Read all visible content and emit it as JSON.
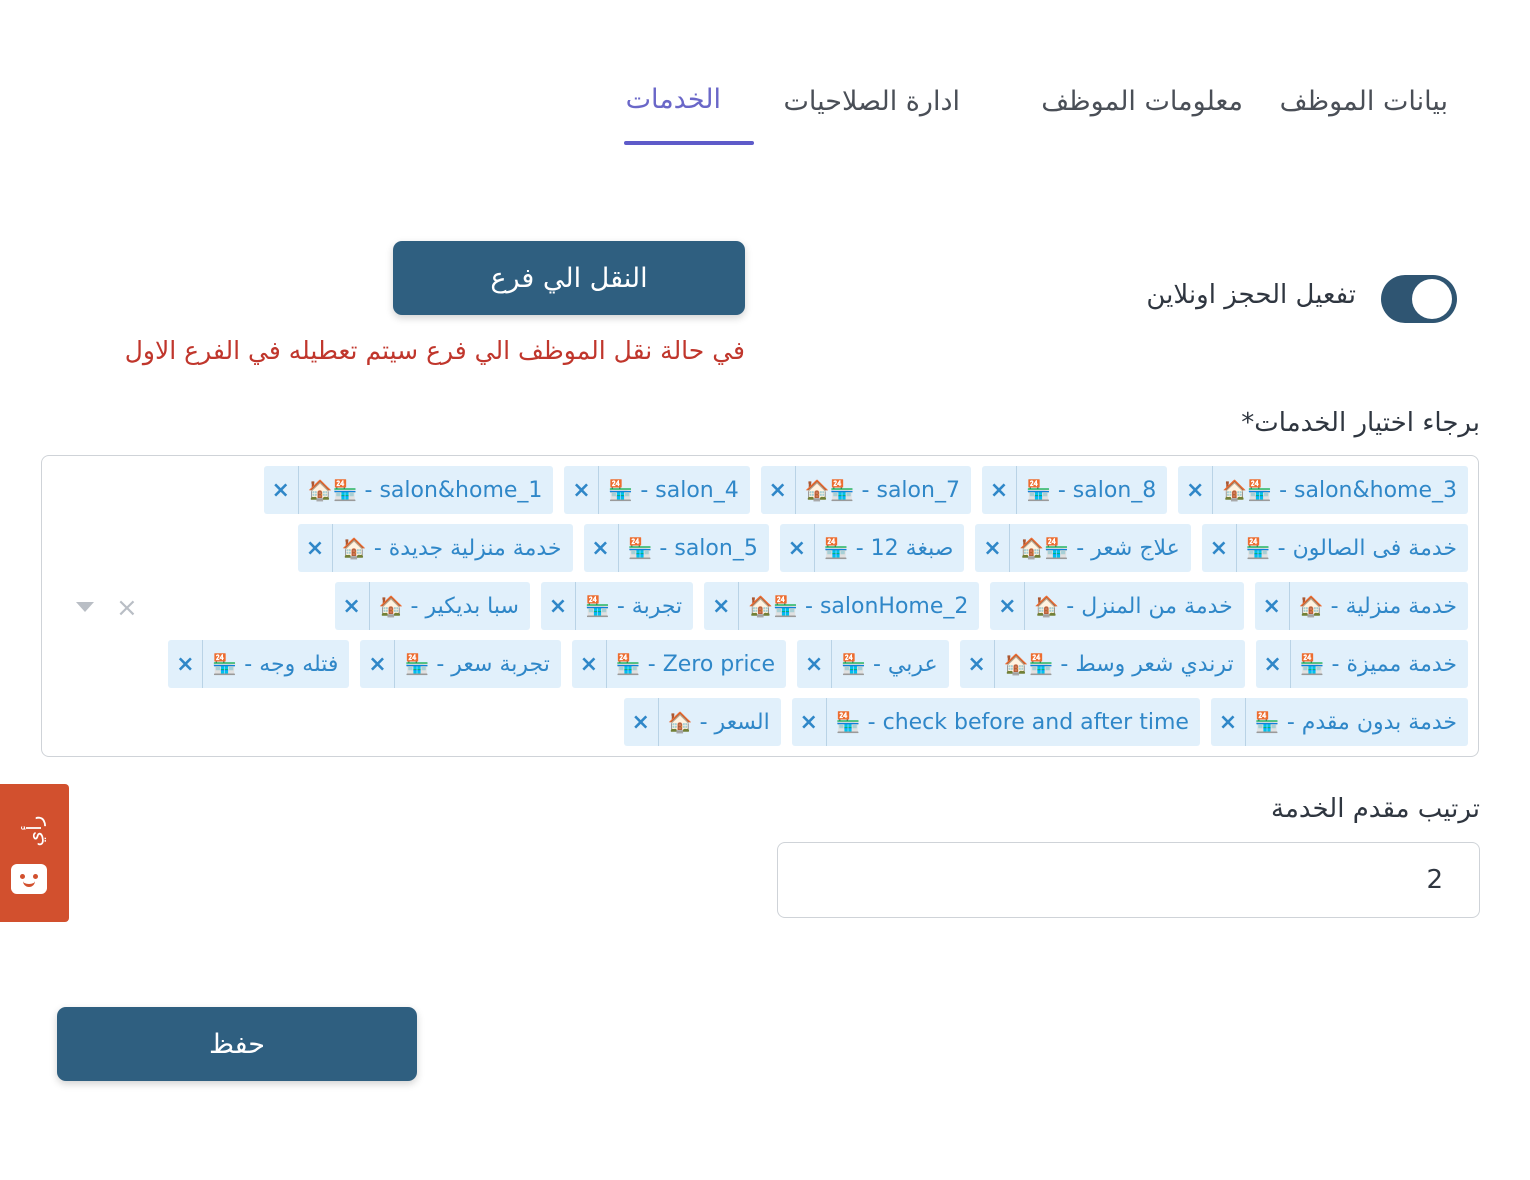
{
  "tabs": [
    {
      "label": "بيانات الموظف"
    },
    {
      "label": "معلومات الموظف"
    },
    {
      "label": "ادارة الصلاحيات"
    },
    {
      "label": "الخدمات",
      "active": true
    }
  ],
  "online_booking": {
    "label": "تفعيل الحجز اونلاين",
    "enabled": true
  },
  "transfer": {
    "button_label": "النقل الي فرع",
    "warning": "في حالة نقل الموظف الي فرع سيتم تعطيله في الفرع الاول"
  },
  "services": {
    "label": "برجاء اختيار الخدمات*",
    "remove_glyph": "×",
    "clear_glyph": "×",
    "selected": [
      {
        "text": "salon&home_3 - ",
        "emoji": "🏪🏠"
      },
      {
        "text": "salon_8 - ",
        "emoji": "🏪"
      },
      {
        "text": "salon_7 - ",
        "emoji": "🏪🏠"
      },
      {
        "text": "salon_4 - ",
        "emoji": "🏪"
      },
      {
        "text": "salon&home_1 - ",
        "emoji": "🏪🏠"
      },
      {
        "text": "خدمة فى الصالون - ",
        "emoji": "🏪"
      },
      {
        "text": "علاج شعر - ",
        "emoji": "🏪🏠"
      },
      {
        "text": "صبغة 12 - ",
        "emoji": "🏪"
      },
      {
        "text": "salon_5 - ",
        "emoji": "🏪"
      },
      {
        "text": "خدمة منزلية جديدة - ",
        "emoji": "🏠"
      },
      {
        "text": "خدمة منزلية - ",
        "emoji": "🏠"
      },
      {
        "text": "خدمة من المنزل - ",
        "emoji": "🏠"
      },
      {
        "text": "salonHome_2 - ",
        "emoji": "🏪🏠"
      },
      {
        "text": "تجربة - ",
        "emoji": "🏪"
      },
      {
        "text": "سبا بديكير - ",
        "emoji": "🏠"
      },
      {
        "text": "خدمة مميزة - ",
        "emoji": "🏪"
      },
      {
        "text": "ترندي شعر وسط - ",
        "emoji": "🏪🏠"
      },
      {
        "text": "عربي - ",
        "emoji": "🏪"
      },
      {
        "text": "Zero price - ",
        "emoji": "🏪"
      },
      {
        "text": "تجربة سعر - ",
        "emoji": "🏪"
      },
      {
        "text": "فتله وجه - ",
        "emoji": "🏪"
      },
      {
        "text": "خدمة بدون مقدم - ",
        "emoji": "🏪"
      },
      {
        "text": "check before and after time - ",
        "emoji": "🏪"
      },
      {
        "text": "السعر - ",
        "emoji": "🏠"
      }
    ]
  },
  "order": {
    "label": "ترتيب مقدم الخدمة",
    "value": "2"
  },
  "save_label": "حفظ",
  "feedback": {
    "label": "رأي"
  },
  "colors": {
    "primary": "#2f5f80",
    "accent": "#5e5bc9",
    "warning": "#c0362c",
    "tag_bg": "#e1f0fb",
    "tag_text": "#2f87c8",
    "feedback": "#d2502e"
  }
}
